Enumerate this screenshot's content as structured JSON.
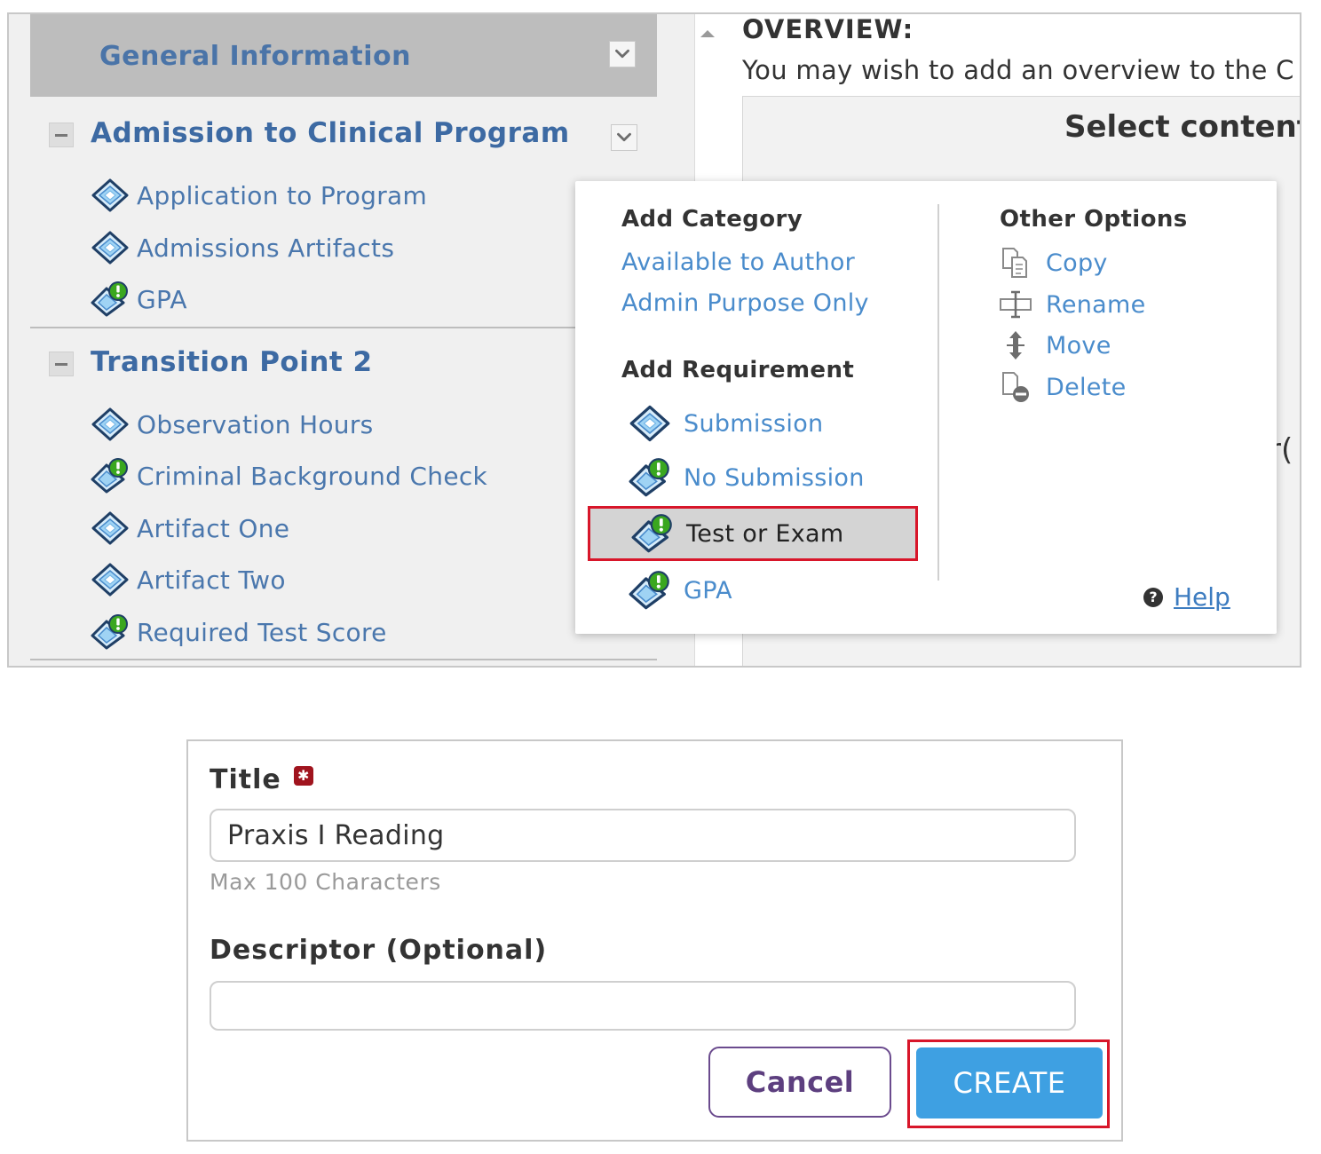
{
  "left_panel": {
    "general_information": "General Information",
    "sections": [
      {
        "title": "Admission to Clinical Program",
        "items": [
          {
            "label": "Application to Program",
            "icon": "submission-diamond-icon"
          },
          {
            "label": "Admissions Artifacts",
            "icon": "submission-diamond-icon"
          },
          {
            "label": "GPA",
            "icon": "no-submission-alert-icon"
          }
        ]
      },
      {
        "title": "Transition Point 2",
        "items": [
          {
            "label": "Observation Hours",
            "icon": "submission-diamond-icon"
          },
          {
            "label": "Criminal Background Check",
            "icon": "no-submission-alert-icon"
          },
          {
            "label": "Artifact One",
            "icon": "submission-diamond-icon"
          },
          {
            "label": "Artifact Two",
            "icon": "submission-diamond-icon"
          },
          {
            "label": "Required Test Score",
            "icon": "no-submission-alert-icon"
          }
        ]
      }
    ]
  },
  "overview": {
    "title": "OVERVIEW:",
    "text": "You may wish to add an overview to the C",
    "select_content": "Select content",
    "partial": "r("
  },
  "menu": {
    "add_category": {
      "heading": "Add Category",
      "links": [
        "Available to Author",
        "Admin Purpose Only"
      ]
    },
    "add_requirement": {
      "heading": "Add Requirement",
      "items": [
        {
          "label": "Submission",
          "icon": "submission-diamond-icon"
        },
        {
          "label": "No Submission",
          "icon": "no-submission-alert-icon"
        },
        {
          "label": "Test or Exam",
          "icon": "no-submission-alert-icon",
          "highlighted": true
        },
        {
          "label": "GPA",
          "icon": "no-submission-alert-icon"
        }
      ]
    },
    "other_options": {
      "heading": "Other Options",
      "items": [
        {
          "label": "Copy",
          "icon": "copy-icon"
        },
        {
          "label": "Rename",
          "icon": "rename-icon"
        },
        {
          "label": "Move",
          "icon": "move-icon"
        },
        {
          "label": "Delete",
          "icon": "delete-icon"
        }
      ]
    },
    "help": "Help"
  },
  "form": {
    "title_label": "Title",
    "title_value": "Praxis I Reading",
    "title_hint": "Max 100 Characters",
    "descriptor_label": "Descriptor (Optional)",
    "descriptor_value": "",
    "cancel": "Cancel",
    "create": "CREATE"
  },
  "colors": {
    "link": "#4a8ccc",
    "section_title": "#3d6aa3",
    "highlight_border": "#d8162a",
    "create_button": "#3ea0e2",
    "cancel_border": "#6b4b8e",
    "alert_green": "#3aa71f"
  }
}
